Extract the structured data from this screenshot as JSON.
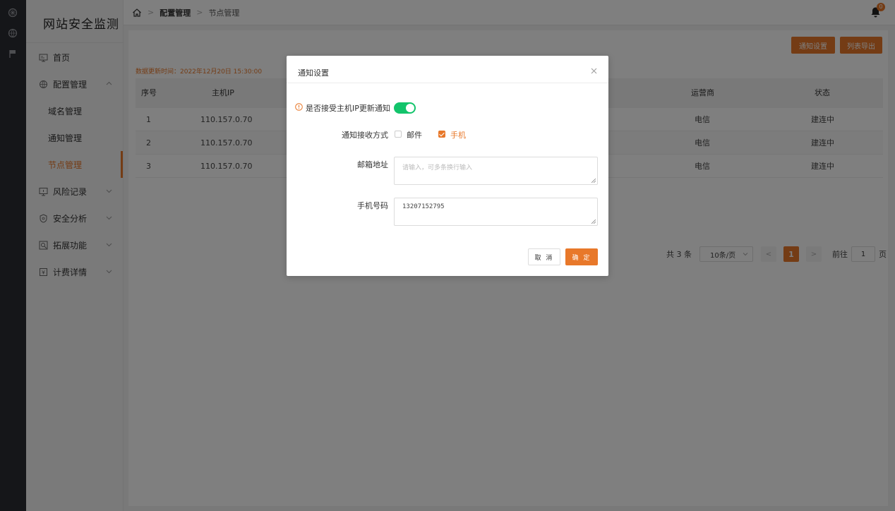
{
  "colors": {
    "accent": "#e8782a",
    "switch_on": "#13c46b",
    "rail": "#2b2d33"
  },
  "rail": {
    "icons": [
      "dashboard-icon",
      "globe-icon",
      "flag-icon"
    ]
  },
  "sidebar": {
    "brand": "网站安全监测",
    "items": [
      {
        "label": "首页",
        "icon": "monitor-icon"
      },
      {
        "label": "配置管理",
        "icon": "globe-icon"
      },
      {
        "label": "域名管理"
      },
      {
        "label": "通知管理"
      },
      {
        "label": "节点管理"
      },
      {
        "label": "风险记录",
        "icon": "screen-icon"
      },
      {
        "label": "安全分析",
        "icon": "shield-icon"
      },
      {
        "label": "拓展功能",
        "icon": "extend-icon"
      },
      {
        "label": "计费详情",
        "icon": "bill-icon"
      }
    ]
  },
  "topbar": {
    "breadcrumb": [
      "配置管理",
      "节点管理"
    ],
    "notification_count": "0"
  },
  "toolbar": {
    "notify_settings": "通知设置",
    "export_list": "列表导出"
  },
  "update_time": "数据更新时间：2022年12月20日 15:30:00",
  "table": {
    "headers": [
      "序号",
      "主机IP",
      "运营商",
      "状态"
    ],
    "rows": [
      {
        "no": "1",
        "ip": "110.157.0.70",
        "isp": "电信",
        "status": "建连中"
      },
      {
        "no": "2",
        "ip": "110.157.0.70",
        "isp": "电信",
        "status": "建连中"
      },
      {
        "no": "3",
        "ip": "110.157.0.70",
        "isp": "电信",
        "status": "建连中"
      }
    ]
  },
  "pagination": {
    "total": "共 3 条",
    "page_size": "10条/页",
    "prev": "<",
    "current": "1",
    "next": ">",
    "goto_label": "前往",
    "goto_value": "1",
    "page_suffix": "页"
  },
  "dialog": {
    "title": "通知设置",
    "accept_label": "是否接受主机IP更新通知",
    "accept_enabled": true,
    "method_label": "通知接收方式",
    "method_email": "邮件",
    "method_email_checked": false,
    "method_phone": "手机",
    "method_phone_checked": true,
    "email_label": "邮箱地址",
    "email_placeholder": "请输入，可多条换行输入",
    "phone_label": "手机号码",
    "phone_value": "13207152795",
    "cancel": "取 消",
    "confirm": "确 定"
  }
}
